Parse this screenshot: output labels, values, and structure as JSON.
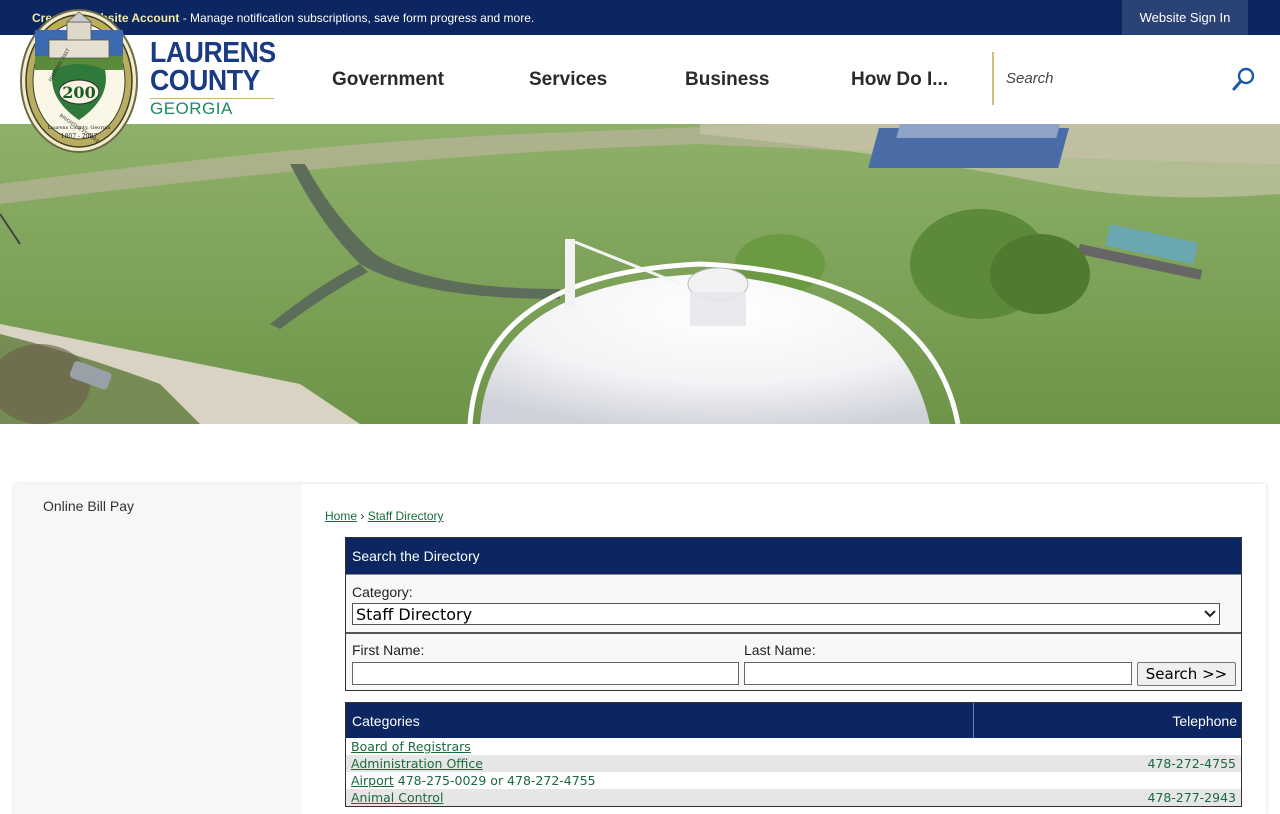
{
  "topbar": {
    "create_link": "Create a Website Account",
    "message": " - Manage notification subscriptions, save form progress and more.",
    "signin": "Website Sign In"
  },
  "brand": {
    "line1": "LAURENS",
    "line2": "COUNTY",
    "line3": "GEORGIA",
    "seal_text_top": "HISTORIC PAST",
    "seal_text_bottom": "BRIGHTER FUTURE",
    "seal_number": "200",
    "seal_place": "Laurens County, Georgia",
    "seal_years": "1807 - 2007"
  },
  "nav": {
    "government": "Government",
    "services": "Services",
    "business": "Business",
    "how_do_i": "How Do I..."
  },
  "search": {
    "placeholder": "Search"
  },
  "sidebar": {
    "online_bill_pay": "Online Bill Pay"
  },
  "breadcrumb": {
    "home": "Home",
    "separator": " › ",
    "current": "Staff Directory"
  },
  "directory": {
    "title": "Search the Directory",
    "category_label": "Category:",
    "category_value": "Staff Directory",
    "first_name_label": "First Name:",
    "last_name_label": "Last Name:",
    "search_button": "Search >>"
  },
  "categories": {
    "header_name": "Categories",
    "header_tel": "Telephone",
    "rows": [
      {
        "name": "Board of Registrars",
        "extra": "",
        "tel": ""
      },
      {
        "name": "Administration Office",
        "extra": "",
        "tel": "478-272-4755"
      },
      {
        "name": "Airport",
        "extra": " 478-275-0029 or 478-272-4755",
        "tel": ""
      },
      {
        "name": "Animal Control",
        "extra": "",
        "tel": "478-277-2943"
      }
    ]
  },
  "colors": {
    "navy": "#0b2660",
    "brand_blue": "#1a3a82",
    "brand_green": "#1f8a5a",
    "link_green": "#1a6b3c",
    "gold": "#d4bf74"
  }
}
